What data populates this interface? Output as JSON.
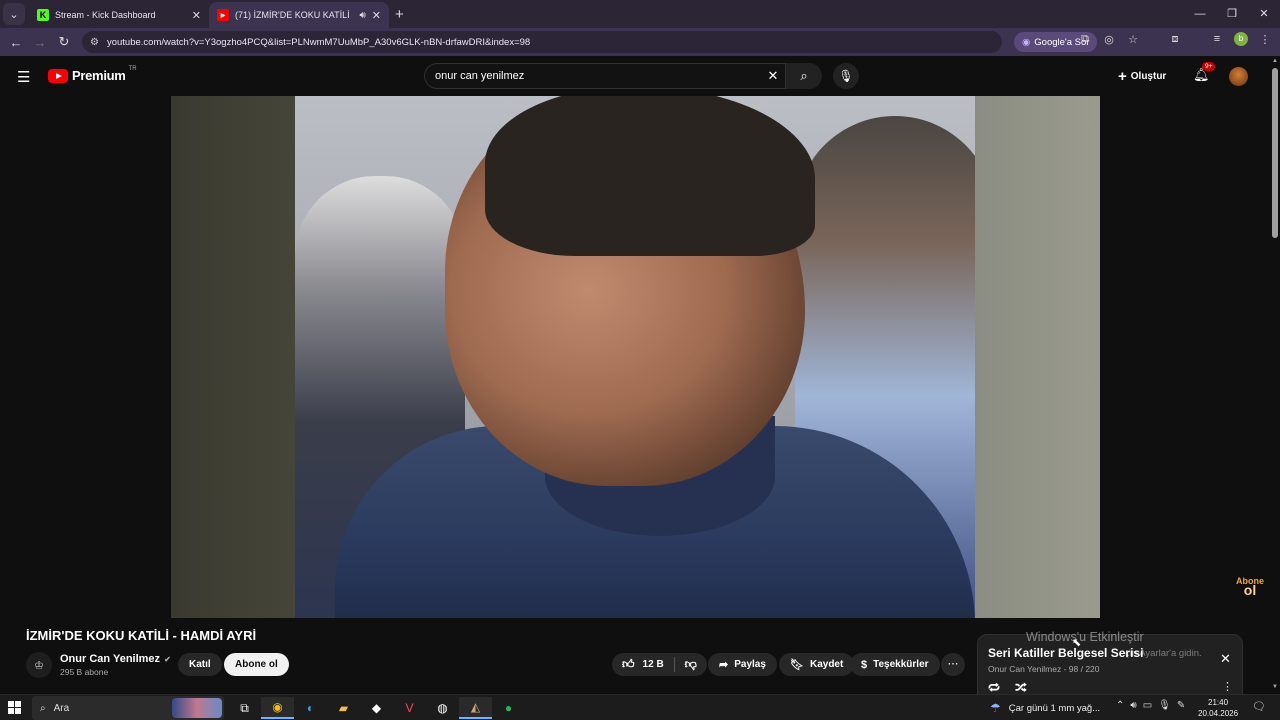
{
  "browser": {
    "tabs": [
      {
        "title": "Stream - Kick Dashboard",
        "favicon_text": "K",
        "favicon_color": "#53fc18",
        "active": false
      },
      {
        "title": "(71) İZMİR'DE KOKU KATİLİ",
        "favicon_text": "▶",
        "favicon_color": "#ff0000",
        "active": true
      }
    ],
    "url": "youtube.com/watch?v=Y3ogzho4PCQ&list=PLNwmM7UuMbP_A30v6GLK-nBN-drfawDRI&index=98",
    "google_sor_label": "Google'a Sor",
    "profile_letter": "b"
  },
  "youtube": {
    "brand": "Premium",
    "country_code": "TR",
    "search_query": "onur can yenilmez",
    "create_label": "Oluştur",
    "notification_count": "9+"
  },
  "video": {
    "title": "İZMİR'DE KOKU KATİLİ - HAMDİ AYRİ",
    "watermark_top": "Abone",
    "watermark_bottom": "ol",
    "channel": {
      "name": "Onur Can Yenilmez",
      "subscribers": "295 B abone",
      "join_label": "Katıl",
      "subscribe_label": "Abone ol"
    },
    "actions": {
      "likes": "12 B",
      "share": "Paylaş",
      "save": "Kaydet",
      "thanks": "Teşekkürler"
    }
  },
  "playlist": {
    "title": "Seri Katiller Belgesel Serisi",
    "meta": "Onur Can Yenilmez - 98 / 220"
  },
  "overlay": {
    "activate_windows": "Windows'u Etkinleştir",
    "activate_hint": "çin Ayarlar'a gidin."
  },
  "taskbar": {
    "search_label": "Ara",
    "weather": "Çar günü 1 mm yağ...",
    "time": "21:40",
    "date": "20.04.2026"
  }
}
